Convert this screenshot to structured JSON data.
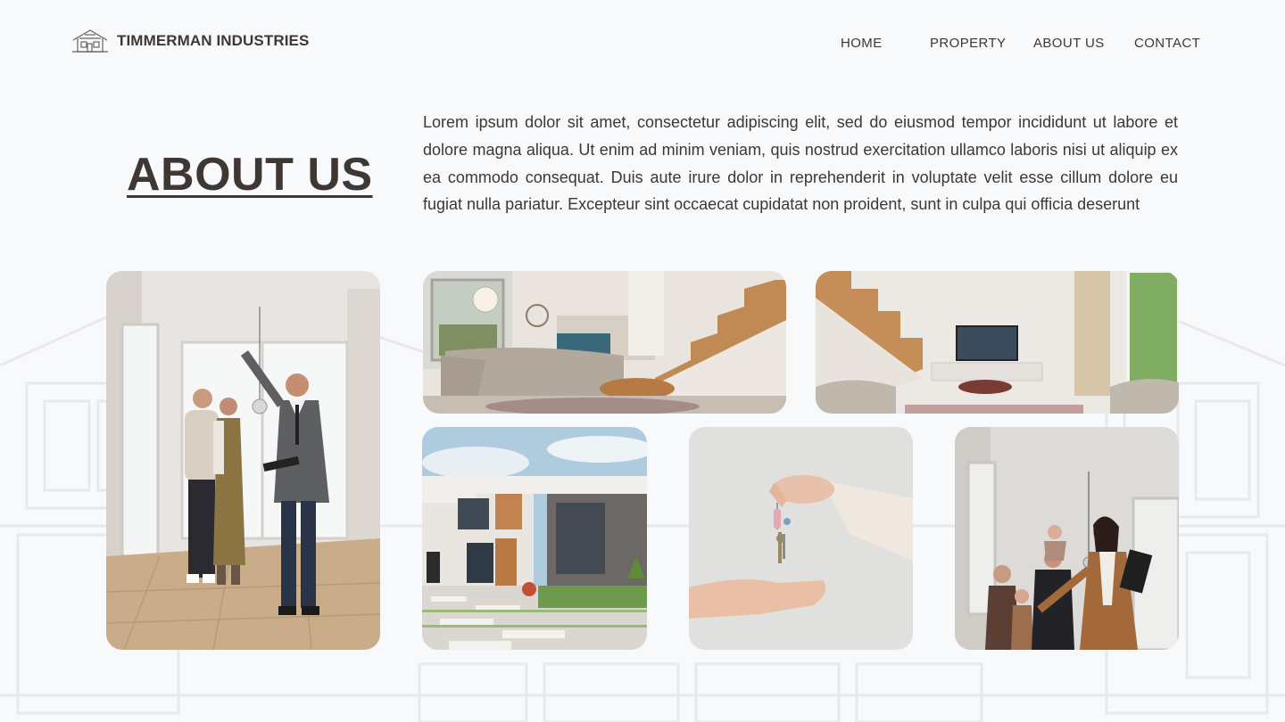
{
  "header": {
    "brand_name": "TIMMERMAN INDUSTRIES",
    "logo_icon": "house-outline-icon",
    "nav": [
      {
        "label": "HOME"
      },
      {
        "label": "PROPERTY"
      },
      {
        "label": "ABOUT US"
      },
      {
        "label": "CONTACT"
      }
    ]
  },
  "about": {
    "title": "ABOUT US",
    "text": "Lorem ipsum dolor sit amet, consectetur adipiscing elit, sed do eiusmod tempor incididunt ut labore et dolore magna aliqua. Ut enim ad minim veniam, quis nostrud exercitation ullamco laboris nisi ut aliquip ex ea commodo consequat. Duis aute irure dolor in reprehenderit in voluptate velit esse cillum dolore eu fugiat nulla pariatur. Excepteur sint occaecat cupidatat non proident, sunt in culpa qui officia deserunt"
  },
  "colors": {
    "background": "#f8f9fa",
    "text": "#3f3733"
  }
}
